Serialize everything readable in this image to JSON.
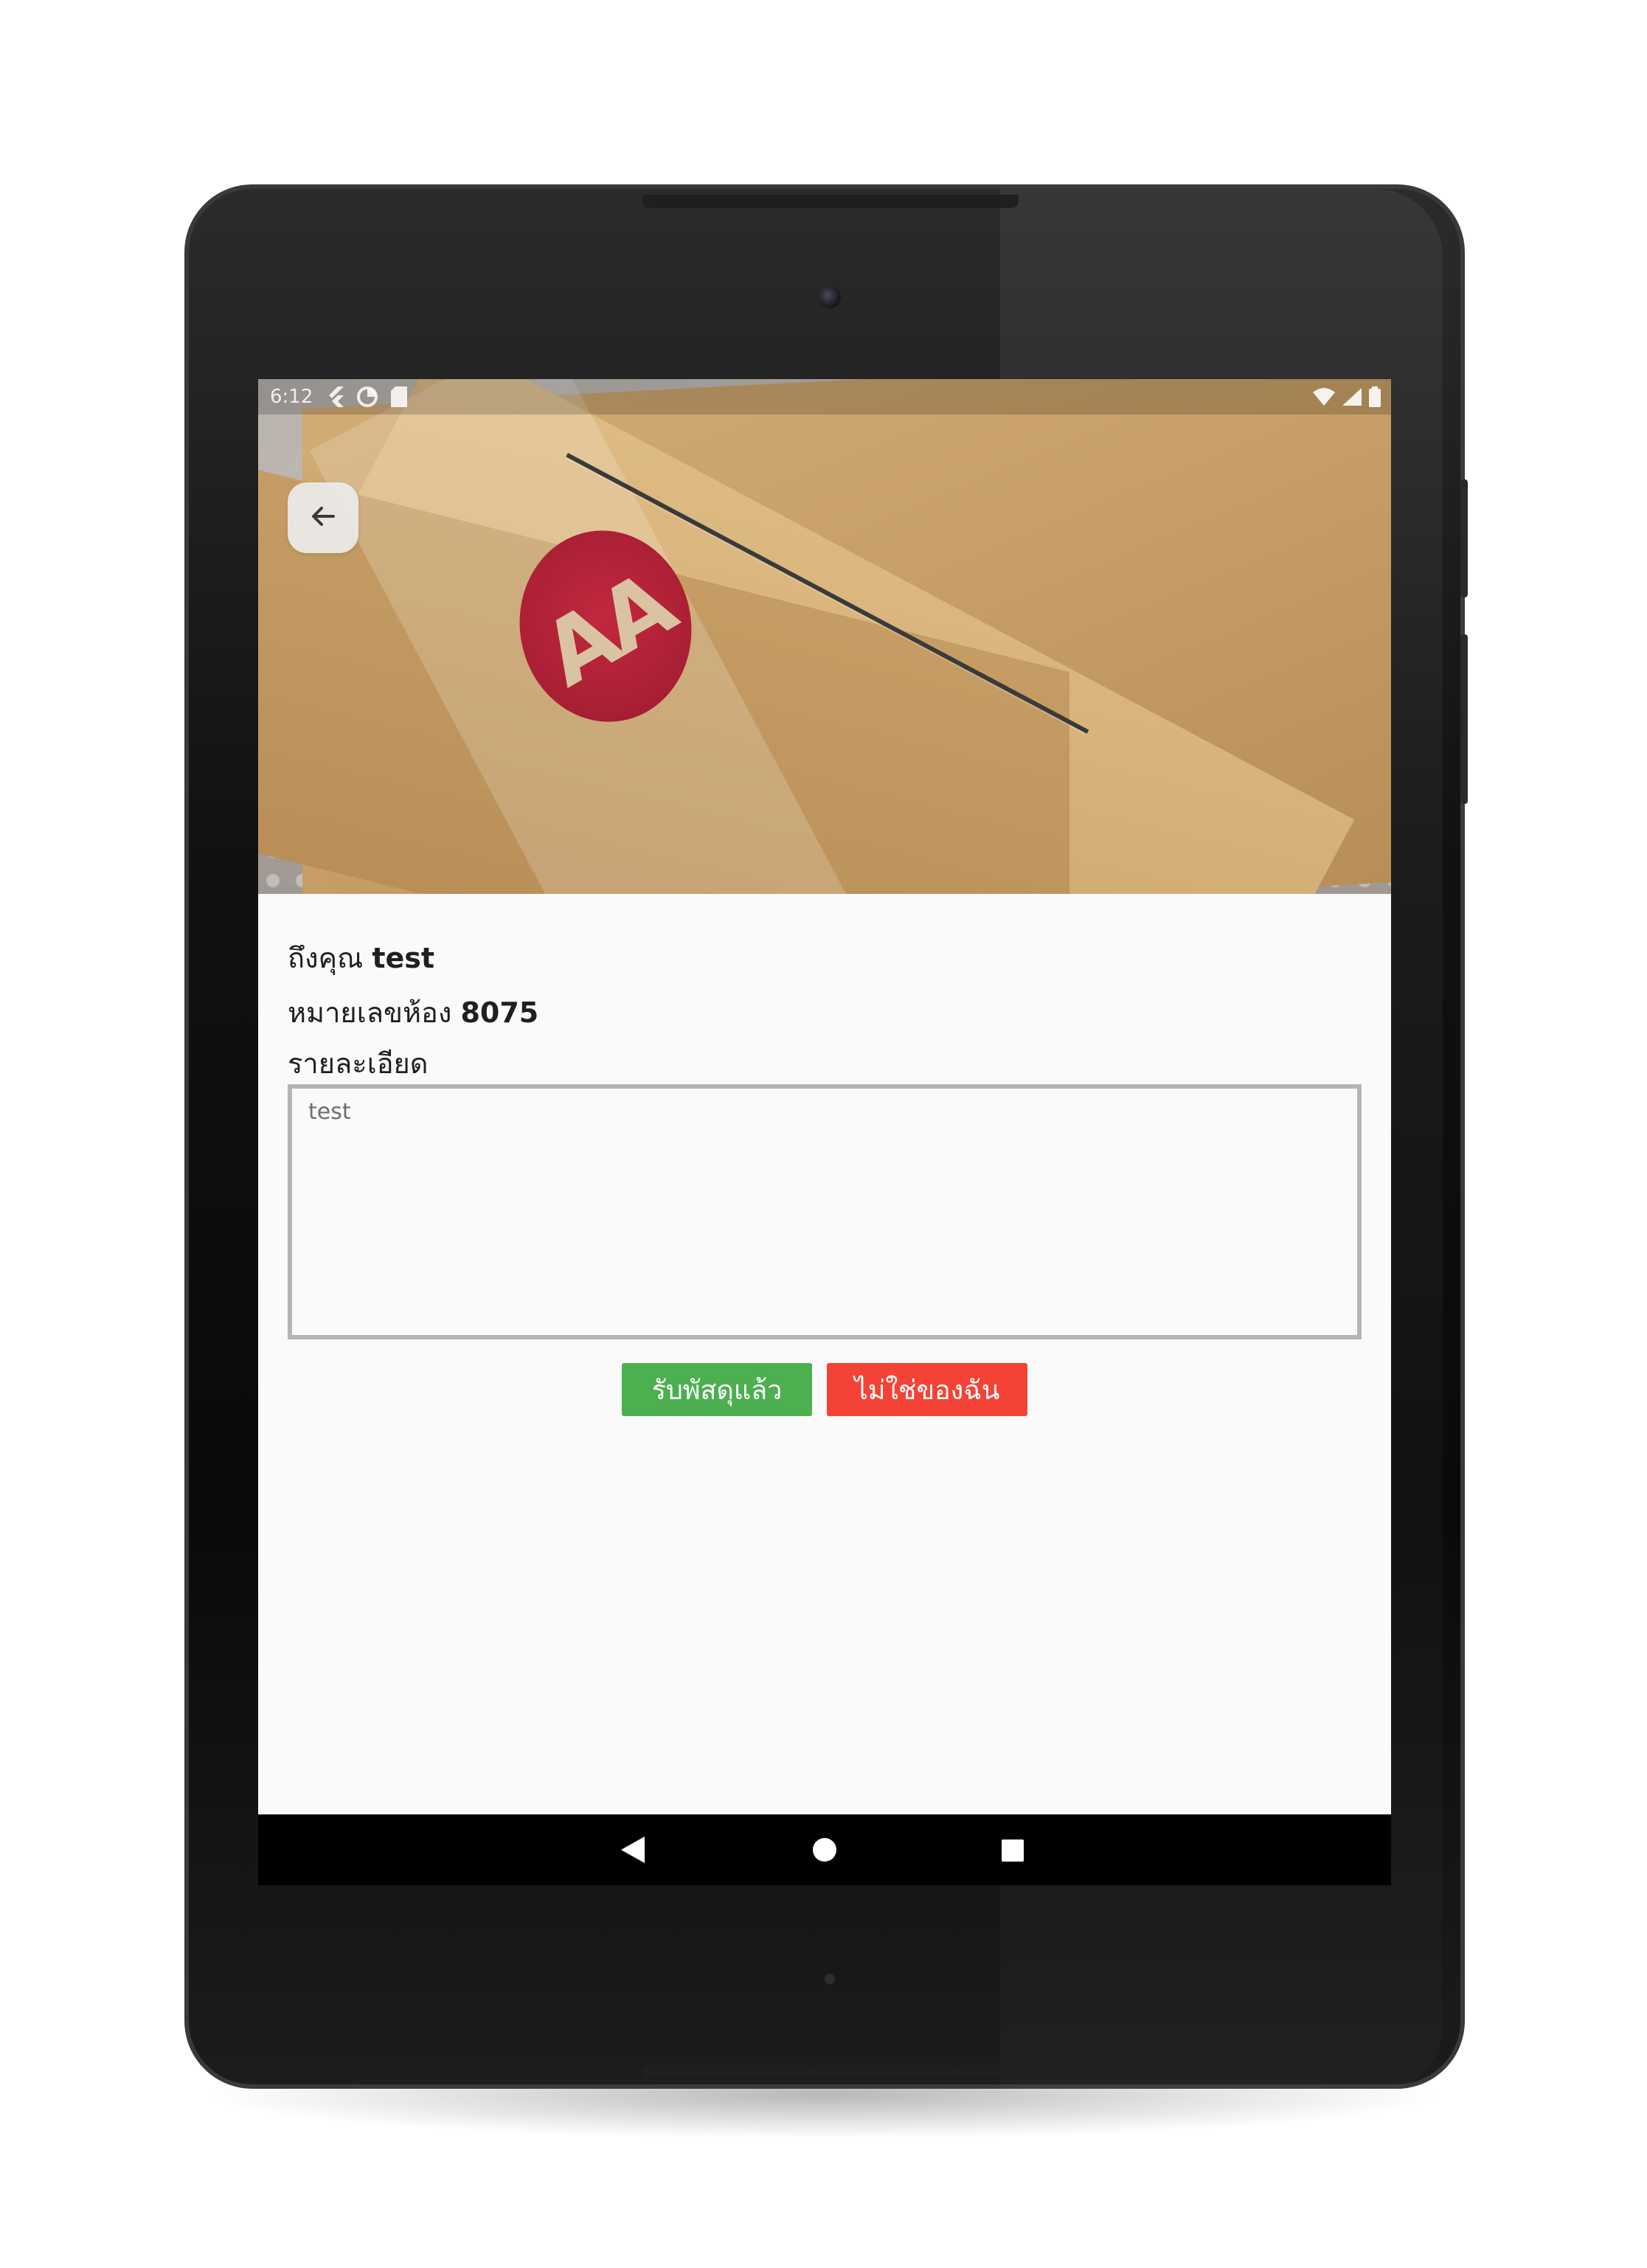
{
  "status_bar": {
    "time": "6:12",
    "left_icons": [
      "flutter-icon",
      "data-saver-icon",
      "sd-card-icon"
    ],
    "right_icons": [
      "wifi-icon",
      "signal-icon",
      "battery-icon"
    ]
  },
  "hero": {
    "sticker_text": "AA"
  },
  "recipient": {
    "prefix": "ถึงคุณ",
    "name": "test"
  },
  "room": {
    "prefix": "หมายเลขห้อง",
    "number": "8075"
  },
  "details": {
    "label": "รายละเอียด",
    "value": "test"
  },
  "actions": {
    "received_label": "รับพัสดุแล้ว",
    "not_mine_label": "ไม่ใช่ของฉัน"
  },
  "colors": {
    "received": "#4caf50",
    "not_mine": "#f44336"
  },
  "nav": {
    "icons": [
      "nav-back-icon",
      "nav-home-icon",
      "nav-recents-icon"
    ]
  }
}
